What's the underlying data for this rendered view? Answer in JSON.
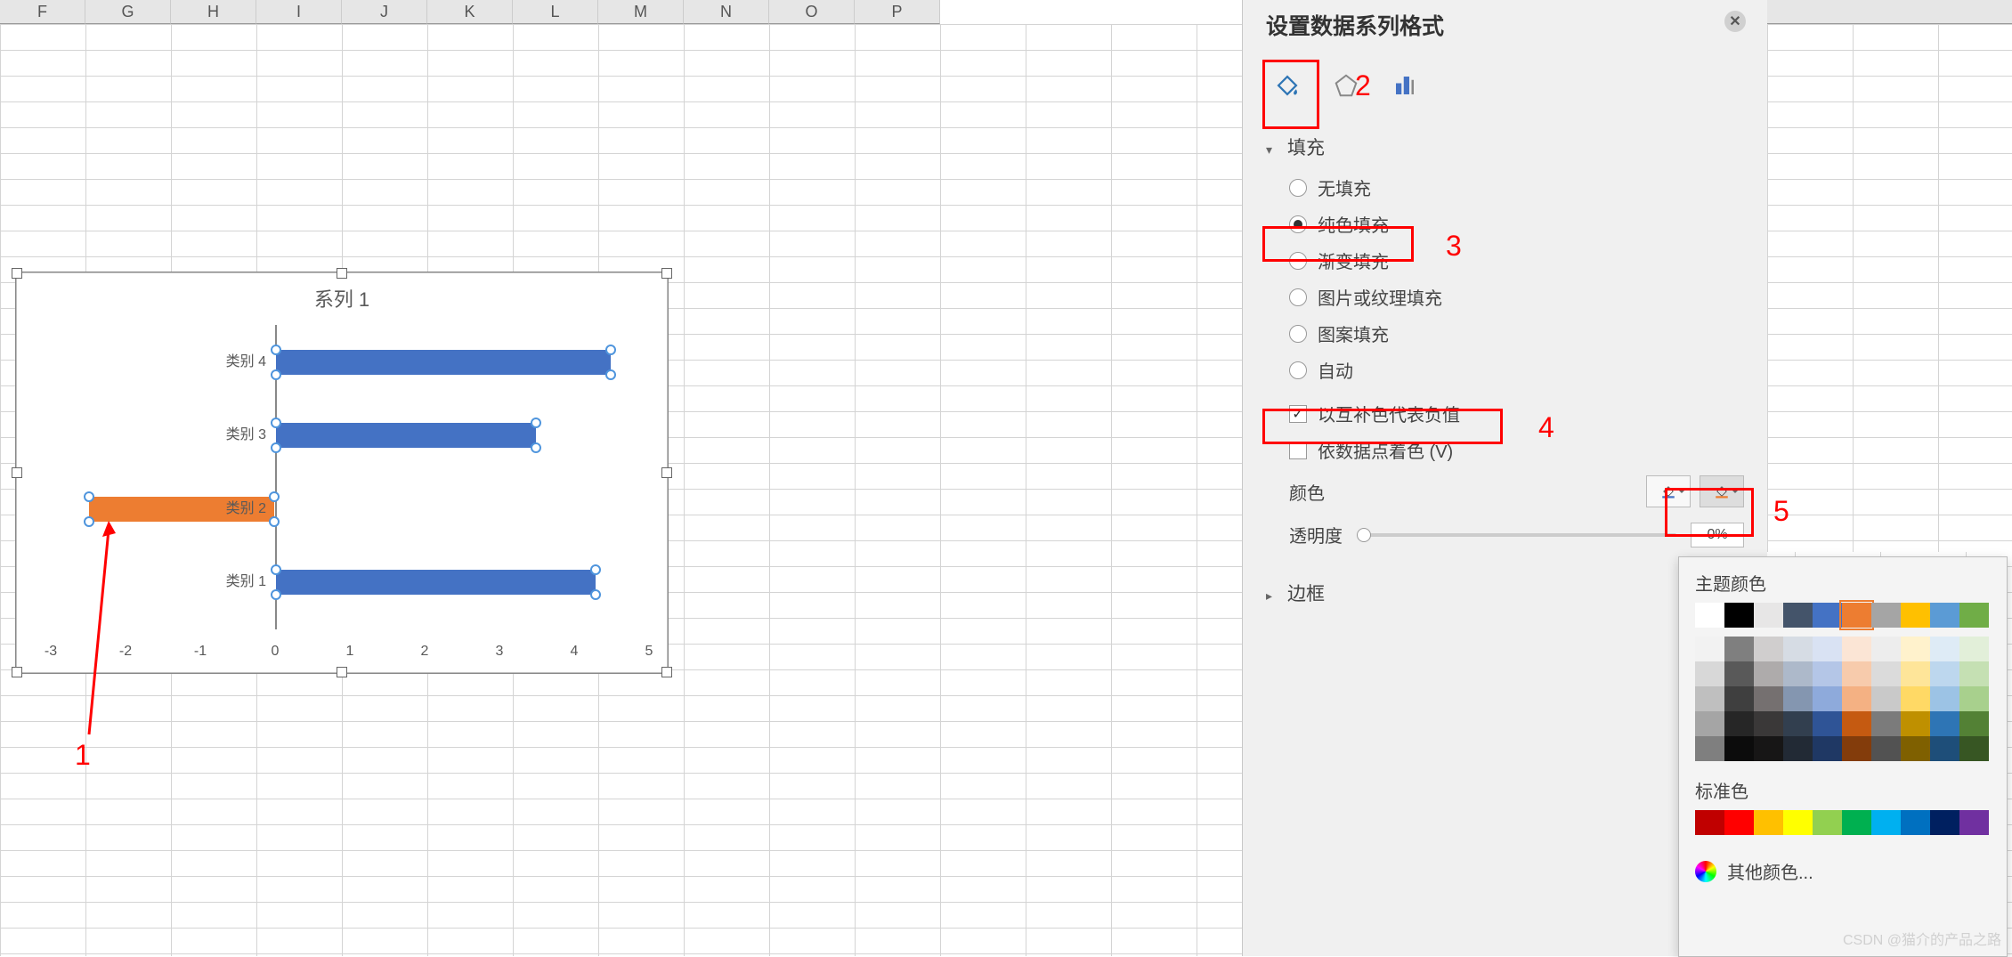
{
  "columns": [
    "F",
    "G",
    "H",
    "I",
    "J",
    "K",
    "L",
    "M",
    "N",
    "O",
    "P"
  ],
  "panel": {
    "title": "设置数据系列格式",
    "fill_section": "填充",
    "options": {
      "none": "无填充",
      "solid": "纯色填充",
      "gradient": "渐变填充",
      "picture": "图片或纹理填充",
      "pattern": "图案填充",
      "auto": "自动"
    },
    "invert_neg": "以互补色代表负值",
    "vary_colors": "依数据点着色 (V)",
    "color_label": "颜色",
    "transparency_label": "透明度",
    "transparency_value": "0%",
    "border_section": "边框"
  },
  "picker": {
    "theme_label": "主题颜色",
    "standard_label": "标准色",
    "more_colors": "其他颜色...",
    "theme_row1": [
      "#ffffff",
      "#000000",
      "#e7e6e6",
      "#44546a",
      "#4472c4",
      "#ed7d31",
      "#a5a5a5",
      "#ffc000",
      "#5b9bd5",
      "#70ad47"
    ],
    "theme_shades": [
      [
        "#f2f2f2",
        "#7f7f7f",
        "#d0cece",
        "#d6dce4",
        "#d9e2f3",
        "#fbe5d5",
        "#ededed",
        "#fff2cc",
        "#deebf6",
        "#e2efd9"
      ],
      [
        "#d8d8d8",
        "#595959",
        "#aeabab",
        "#adb9ca",
        "#b4c6e7",
        "#f7cbac",
        "#dbdbdb",
        "#fee599",
        "#bdd7ee",
        "#c5e0b3"
      ],
      [
        "#bfbfbf",
        "#3f3f3f",
        "#757070",
        "#8496b0",
        "#8eaadb",
        "#f4b183",
        "#c9c9c9",
        "#ffd965",
        "#9cc3e5",
        "#a8d08d"
      ],
      [
        "#a5a5a5",
        "#262626",
        "#3a3838",
        "#323f4f",
        "#2f5496",
        "#c55a11",
        "#7b7b7b",
        "#bf9000",
        "#2e75b5",
        "#538135"
      ],
      [
        "#7f7f7f",
        "#0c0c0c",
        "#171616",
        "#222a35",
        "#1f3864",
        "#833c0b",
        "#525252",
        "#7f6000",
        "#1e4e79",
        "#375623"
      ]
    ],
    "standard": [
      "#c00000",
      "#ff0000",
      "#ffc000",
      "#ffff00",
      "#92d050",
      "#00b050",
      "#00b0f0",
      "#0070c0",
      "#002060",
      "#7030a0"
    ]
  },
  "chart_data": {
    "type": "bar",
    "title": "系列 1",
    "categories": [
      "类别 1",
      "类别 2",
      "类别 3",
      "类别 4"
    ],
    "values": [
      4.3,
      -2.5,
      3.5,
      4.5
    ],
    "xlim": [
      -3,
      5
    ],
    "negative_color": "#ed7d31",
    "positive_color": "#4472c4"
  },
  "annotations": {
    "a1": "1",
    "a2": "2",
    "a3": "3",
    "a4": "4",
    "a5": "5"
  },
  "watermark": "CSDN @猫介的产品之路"
}
